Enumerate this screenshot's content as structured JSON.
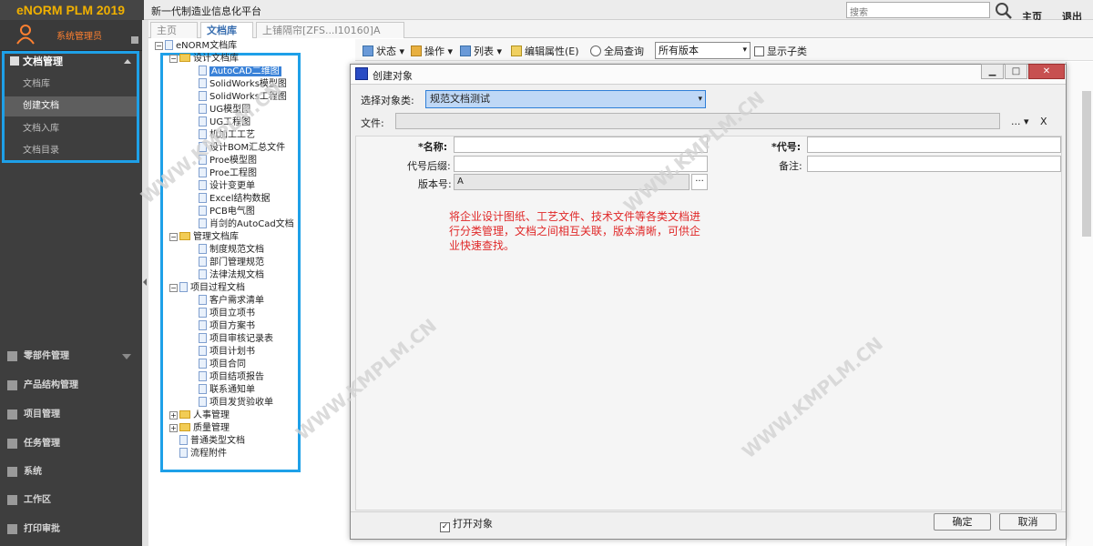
{
  "app": {
    "brand": "eNORM PLM 2019",
    "subtitle": "新一代制造业信息化平台"
  },
  "header": {
    "search_placeholder": "搜索",
    "home": "主页",
    "logout": "退出"
  },
  "user": {
    "name": "系统管理员"
  },
  "menu": {
    "section": "文档管理",
    "items": [
      "文档库",
      "创建文档",
      "文档入库",
      "文档目录"
    ],
    "main": [
      "零部件管理",
      "产品结构管理",
      "项目管理",
      "任务管理",
      "系统",
      "工作区",
      "打印审批"
    ]
  },
  "tabs": [
    "主页",
    "文档库",
    "上铺隔帘[ZFS...I10160]A"
  ],
  "tree": {
    "root": "eNORM文档库",
    "design": "设计文档库",
    "design_items": [
      "AutoCAD二维图",
      "SolidWorks模型图",
      "SolidWorks工程图",
      "UG模型图",
      "UG工程图",
      "机加工工艺",
      "设计BOM汇总文件",
      "Proe模型图",
      "Proe工程图",
      "设计变更单",
      "Excel结构数据",
      "PCB电气图",
      "肖剑的AutoCad文档"
    ],
    "manage": "管理文档库",
    "manage_items": [
      "制度规范文档",
      "部门管理规范",
      "法律法规文档"
    ],
    "project": "项目过程文档",
    "project_items": [
      "客户需求清单",
      "项目立项书",
      "项目方案书",
      "项目审核记录表",
      "项目计划书",
      "项目合同",
      "项目结项报告",
      "联系通知单",
      "项目发货验收单"
    ],
    "others": [
      "人事管理",
      "质量管理"
    ],
    "leaf": [
      "普通类型文档",
      "流程附件"
    ]
  },
  "toolbar": {
    "status": "状态",
    "operate": "操作",
    "list": "列表",
    "edit_attr": "编辑属性(E)",
    "global_query": "全局查询",
    "version": "所有版本",
    "show_children": "显示子类"
  },
  "dialog": {
    "title": "创建对象",
    "type_label": "选择对象类:",
    "type_value": "规范文档测试",
    "file_label": "文件:",
    "file_more": "...",
    "file_clear": "X",
    "name_label": "*名称:",
    "name_value": "",
    "code_label": "*代号:",
    "suffix_label": "代号后缀:",
    "remark_label": "备注:",
    "version_label": "版本号:",
    "version_value": "A",
    "version_btn": "···",
    "note": "将企业设计图纸、工艺文件、技术文件等各类文档进行分类管理，文档之间相互关联，版本清晰，可供企业快速查找。",
    "open_object": "打开对象",
    "ok": "确定",
    "cancel": "取消"
  },
  "watermark": "WWW.KMPLM.CN",
  "colors": {
    "highlight": "#1ea0e8",
    "note": "#e02828",
    "brand": "#f0b000"
  }
}
